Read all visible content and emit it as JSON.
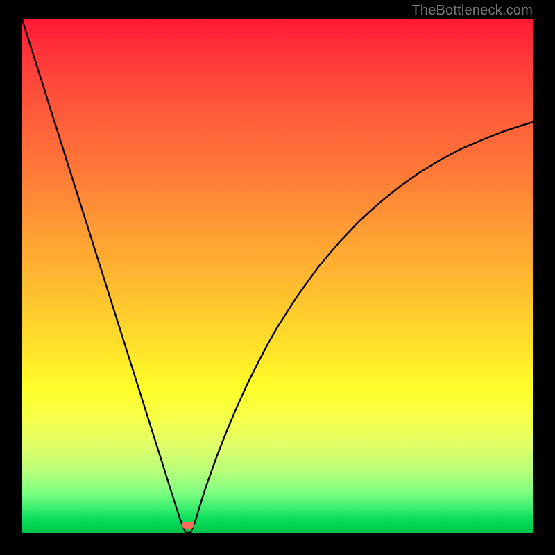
{
  "attribution": "TheBottleneck.com",
  "chart_data": {
    "type": "line",
    "title": "",
    "xlabel": "",
    "ylabel": "",
    "xlim": [
      0,
      100
    ],
    "ylim": [
      0,
      100
    ],
    "grid": false,
    "legend": false,
    "annotations": {
      "dip_marker": {
        "x": 32.5,
        "y": 1.5,
        "color": "#ff6a5a"
      }
    },
    "background_gradient": [
      "#ff1a33",
      "#ff7a38",
      "#ffe22a",
      "#ffff2a",
      "#00c048"
    ],
    "x": [
      0,
      2,
      4,
      6,
      8,
      10,
      12,
      14,
      16,
      18,
      20,
      22,
      24,
      26,
      28,
      30,
      31,
      32,
      33,
      34,
      35,
      36,
      38,
      40,
      42,
      44,
      46,
      48,
      50,
      54,
      58,
      62,
      66,
      70,
      74,
      78,
      82,
      86,
      90,
      94,
      98,
      100
    ],
    "y": [
      100,
      93.7,
      87.4,
      81.1,
      74.8,
      68.5,
      62.2,
      55.9,
      49.6,
      43.3,
      37.0,
      30.7,
      24.4,
      18.1,
      11.8,
      5.5,
      2.4,
      0.0,
      0.0,
      2.6,
      5.9,
      9.0,
      14.6,
      19.7,
      24.4,
      28.8,
      32.8,
      36.6,
      40.1,
      46.3,
      51.8,
      56.5,
      60.7,
      64.3,
      67.5,
      70.3,
      72.7,
      74.8,
      76.5,
      78.1,
      79.4,
      80.0
    ]
  }
}
